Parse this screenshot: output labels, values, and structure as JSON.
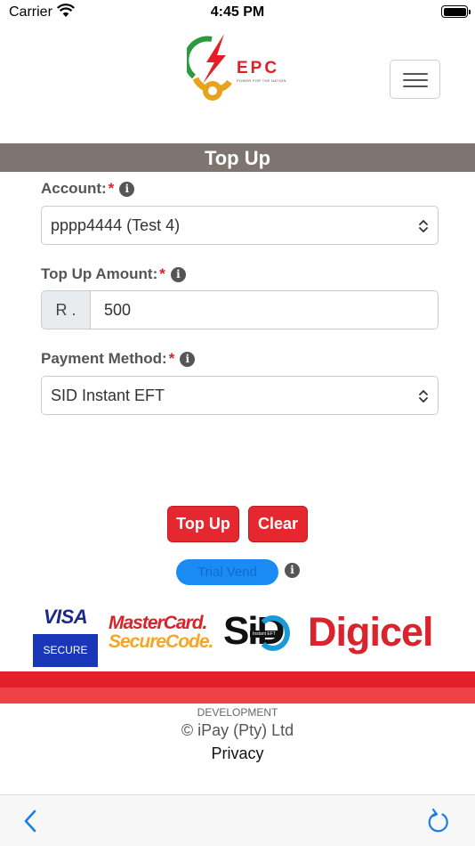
{
  "status_bar": {
    "carrier": "Carrier",
    "time": "4:45 PM",
    "icons": [
      "wifi-icon",
      "battery-icon"
    ]
  },
  "header": {
    "logo_text": "EPC",
    "logo_tagline": "POWER FOR THE NATION",
    "menu_icon": "hamburger-menu-icon"
  },
  "page": {
    "title": "Top Up"
  },
  "form": {
    "account": {
      "label": "Account:",
      "required_mark": "*",
      "selected": "pppp4444 (Test 4)"
    },
    "amount": {
      "label": "Top Up Amount:",
      "required_mark": "*",
      "currency_prefix": "R .",
      "value": "500"
    },
    "payment_method": {
      "label": "Payment Method:",
      "required_mark": "*",
      "selected": "SID Instant EFT"
    },
    "info_glyph": "i"
  },
  "actions": {
    "top_up_label": "Top Up",
    "clear_label": "Clear",
    "trial_vend_label": "Trial Vend"
  },
  "payment_logos": {
    "visa_word": "VISA",
    "visa_sub": "SECURE",
    "mastercard_line1": "MasterCard.",
    "mastercard_line2": "SecureCode.",
    "sid_text": "SiD",
    "sid_badge": "Instant EFT",
    "digicel": "Digicel"
  },
  "footer": {
    "environment": "DEVELOPMENT",
    "copyright": "© iPay (Pty) Ltd",
    "privacy": "Privacy"
  },
  "toolbar": {
    "back_icon": "chevron-left-icon",
    "reload_icon": "reload-icon"
  },
  "colors": {
    "title_band": "#7e7570",
    "primary_red": "#e5282f",
    "trial_blue": "#1a8bf2",
    "toolbar_blue": "#1a7ee6"
  }
}
